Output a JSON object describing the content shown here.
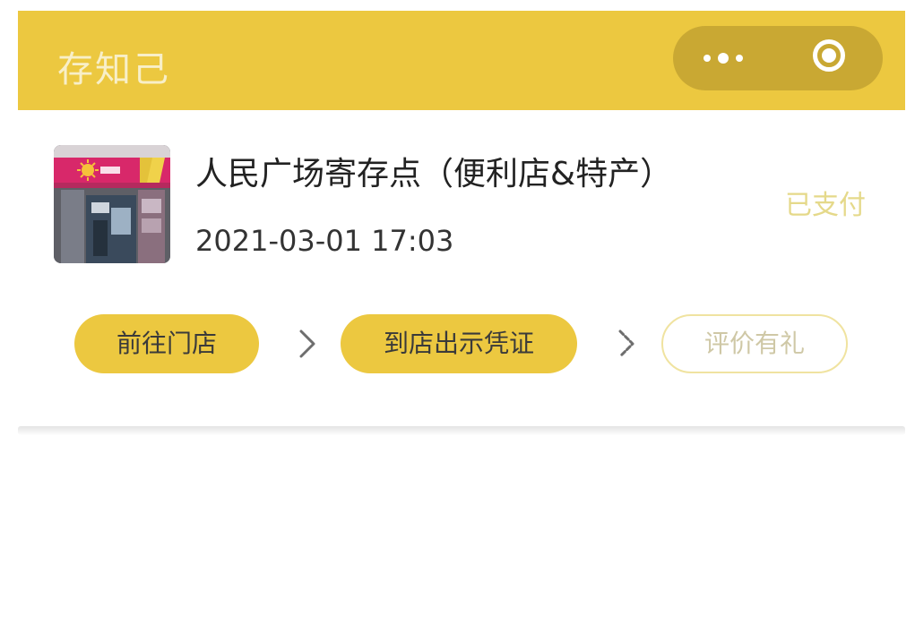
{
  "header": {
    "title": "存知己",
    "bg_color": "#ecc840",
    "capsule": {
      "more_icon": "more-dots-icon",
      "close_icon": "target-circle-icon"
    }
  },
  "order": {
    "store_name": "人民广场寄存点（便利店&特产）",
    "time": "2021-03-01 17:03",
    "status": "已支付",
    "thumbnail": "store-front-photo",
    "steps": [
      {
        "label": "前往门店",
        "style": "filled"
      },
      {
        "label": "到店出示凭证",
        "style": "filled"
      },
      {
        "label": "评价有礼",
        "style": "outline"
      }
    ],
    "step_separator_icon": "chevron-right-icon"
  }
}
